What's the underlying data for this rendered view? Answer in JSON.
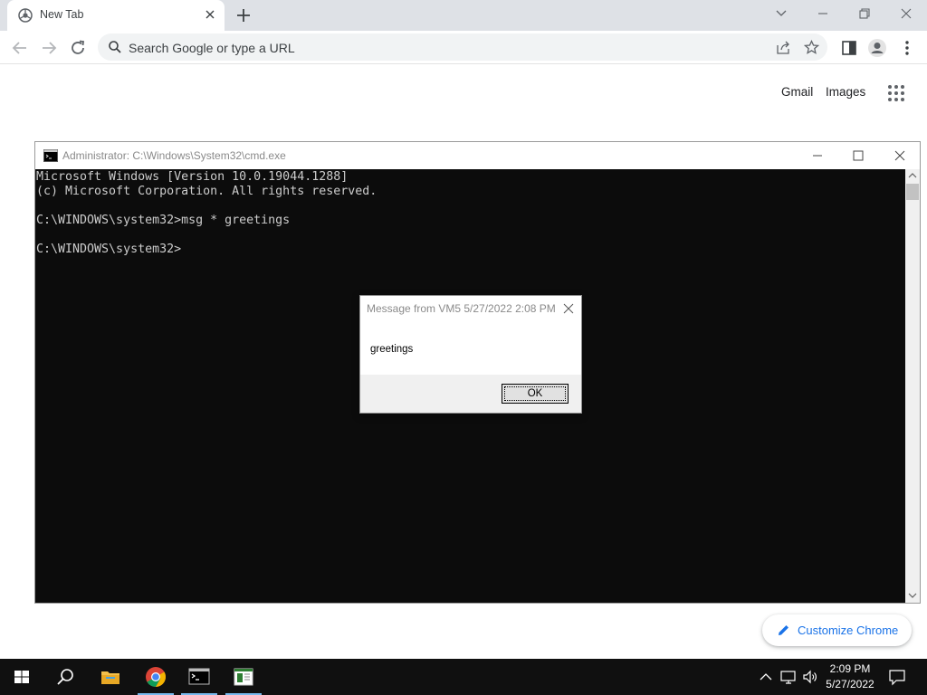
{
  "browser": {
    "tab_title": "New Tab",
    "omnibox_placeholder": "Search Google or type a URL",
    "ntp_links": [
      "Gmail",
      "Images"
    ],
    "customize_label": "Customize Chrome"
  },
  "cmd_window": {
    "title": "Administrator: C:\\Windows\\System32\\cmd.exe",
    "lines": [
      "Microsoft Windows [Version 10.0.19044.1288]",
      "(c) Microsoft Corporation. All rights reserved.",
      "",
      "C:\\WINDOWS\\system32>msg * greetings",
      "",
      "C:\\WINDOWS\\system32>"
    ]
  },
  "message_dialog": {
    "title": "Message from VM5 5/27/2022 2:08 PM",
    "body": "greetings",
    "ok_label": "OK"
  },
  "taskbar": {
    "pinned": [
      "start-icon",
      "search-icon",
      "file-explorer-icon",
      "chrome-icon",
      "cmd-icon",
      "app-icon"
    ],
    "tray": [
      "chevron-up-icon",
      "network-icon",
      "volume-icon"
    ],
    "time": "2:09 PM",
    "date": "5/27/2022"
  },
  "colors": {
    "chrome_tabstrip": "#dee1e6",
    "console_bg": "#0c0c0c",
    "console_text": "#cccccc",
    "link_blue": "#1a73e8",
    "taskbar_bg": "#101010",
    "taskbar_active": "#76b9ed"
  }
}
